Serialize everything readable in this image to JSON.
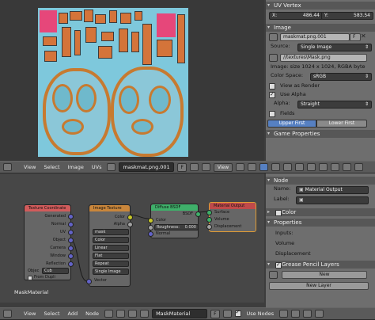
{
  "uv_vertex": {
    "title": "UV Vertex",
    "x_label": "X:",
    "x_value": "486.44",
    "y_label": "Y:",
    "y_value": "583.54"
  },
  "image_panel": {
    "title": "Image",
    "image_name": "maskmat.png.001",
    "f_label": "F",
    "source_label": "Source:",
    "source_value": "Single Image",
    "filepath": "//textures\\Mask.png",
    "info": "Image: size 1024 x 1024, RGBA byte",
    "color_space_label": "Color Space:",
    "color_space_value": "sRGB",
    "view_as_render": "View as Render",
    "use_alpha": "Use Alpha",
    "alpha_label": "Alpha:",
    "alpha_value": "Straight",
    "fields": "Fields",
    "upper_first": "Upper First",
    "lower_first": "Lower First"
  },
  "game_properties": {
    "title": "Game Properties"
  },
  "image_header": {
    "view": "View",
    "select": "Select",
    "image": "Image",
    "uvs": "UVs",
    "image_name": "maskmat.png.001",
    "f_label": "F",
    "view_mode": "View"
  },
  "node_panel": {
    "title": "Node",
    "name_label": "Name:",
    "name_value": "Material Output",
    "label_label": "Label:",
    "color": "Color",
    "properties": "Properties",
    "inputs": "Inputs:",
    "volume": "Volume",
    "displacement": "Displacement",
    "grease_pencil": "Grease Pencil Layers",
    "new_btn": "New",
    "new_layer_btn": "New Layer"
  },
  "nodes": {
    "tex_coord": {
      "title": "Texture Coordinate",
      "outputs": [
        "Generated",
        "Normal",
        "UV",
        "Object",
        "Camera",
        "Window",
        "Reflection"
      ],
      "object_label": "Objec",
      "object_value": "Cub",
      "from_dupli": "From Dupli"
    },
    "img_tex": {
      "title": "Image Texture",
      "outputs": [
        "Color",
        "Alpha"
      ],
      "image_value": "mask",
      "dropdowns": [
        "Color",
        "Linear",
        "Flat",
        "Repeat",
        "Single Image"
      ],
      "vector": "Vector"
    },
    "diffuse": {
      "title": "Diffuse BSDF",
      "output": "BSDF",
      "color": "Color",
      "roughness": "Roughness:",
      "roughness_value": "0.000",
      "normal": "Normal"
    },
    "mat_out": {
      "title": "Material Output",
      "inputs": [
        "Surface",
        "Volume",
        "Displacement"
      ]
    }
  },
  "node_editor_label": "MaskMaterial",
  "node_header": {
    "view": "View",
    "select": "Select",
    "add": "Add",
    "node": "Node",
    "material": "MaskMaterial",
    "f_label": "F",
    "use_nodes": "Use Nodes"
  },
  "colors": {
    "selected_blue": "#5680c2",
    "uv_background": "#7ec8dc",
    "texture_orange": "#c77a30",
    "texture_pink": "#e6477a"
  }
}
